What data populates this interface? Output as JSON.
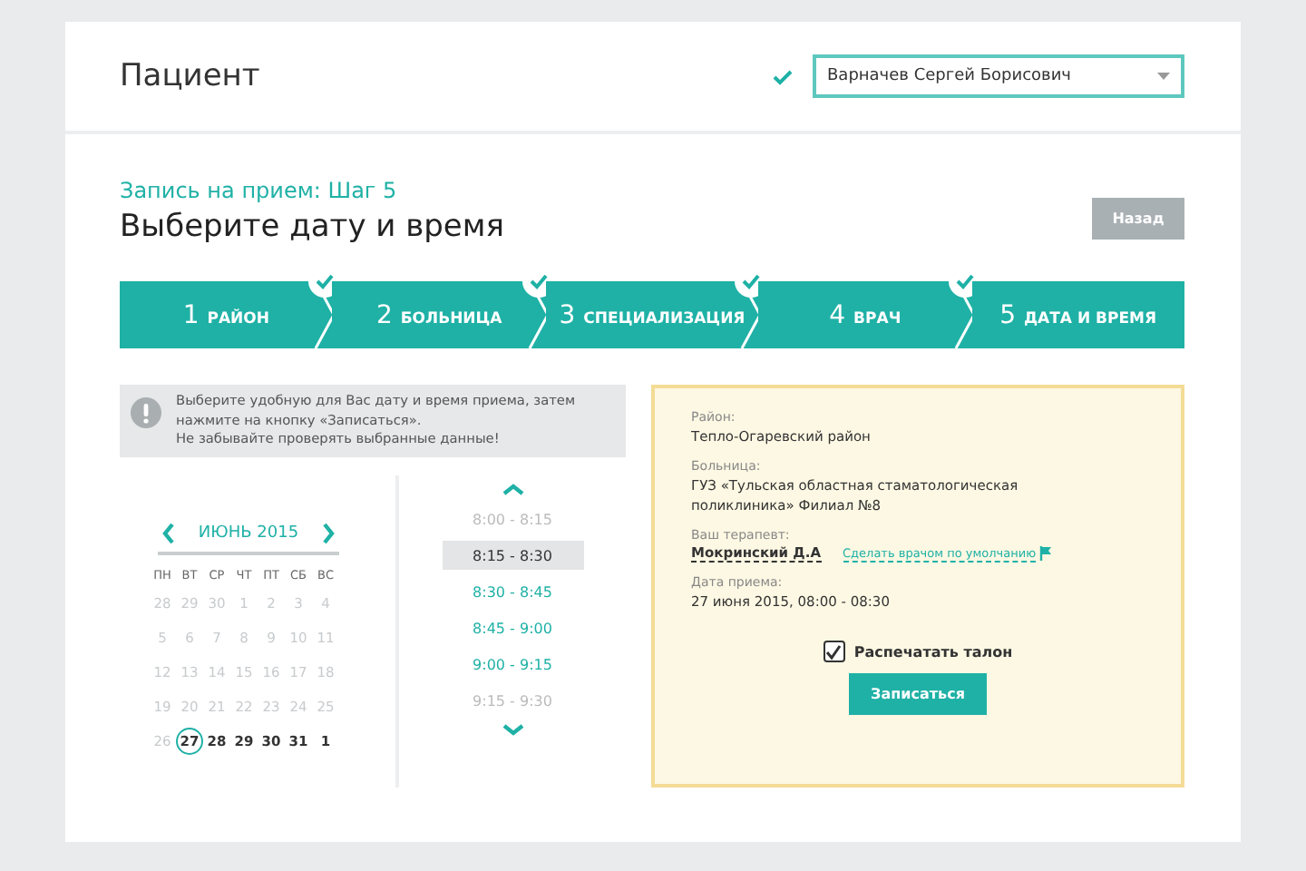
{
  "header": {
    "title": "Пациент",
    "patient_verified": true,
    "patient_select": {
      "value": "Варначев Сергей Борисович"
    }
  },
  "step_label": "Запись на прием: Шаг 5",
  "heading": "Выберите дату и время",
  "back_button": "Назад",
  "steps": [
    {
      "number": "1",
      "label": "РАЙОН",
      "done": true
    },
    {
      "number": "2",
      "label": "БОЛЬНИЦА",
      "done": true
    },
    {
      "number": "3",
      "label": "СПЕЦИАЛИЗАЦИЯ",
      "done": true
    },
    {
      "number": "4",
      "label": "ВРАЧ",
      "done": true
    },
    {
      "number": "5",
      "label": "ДАТА И ВРЕМЯ",
      "done": false
    }
  ],
  "notice": {
    "lines": [
      "Выберите удобную для Вас дату и время приема, затем нажмите на кнопку «Записаться».",
      "Не забывайте проверять выбранные данные!"
    ]
  },
  "calendar": {
    "month": "ИЮНЬ 2015",
    "weekdays": [
      "ПН",
      "ВТ",
      "СР",
      "ЧТ",
      "ПТ",
      "СБ",
      "ВС"
    ],
    "days": [
      {
        "label": "28",
        "disabled": true,
        "selected": false
      },
      {
        "label": "29",
        "disabled": true,
        "selected": false
      },
      {
        "label": "30",
        "disabled": true,
        "selected": false
      },
      {
        "label": "1",
        "disabled": true,
        "selected": false
      },
      {
        "label": "2",
        "disabled": true,
        "selected": false
      },
      {
        "label": "3",
        "disabled": true,
        "selected": false
      },
      {
        "label": "4",
        "disabled": true,
        "selected": false
      },
      {
        "label": "5",
        "disabled": true,
        "selected": false
      },
      {
        "label": "6",
        "disabled": true,
        "selected": false
      },
      {
        "label": "7",
        "disabled": true,
        "selected": false
      },
      {
        "label": "8",
        "disabled": true,
        "selected": false
      },
      {
        "label": "9",
        "disabled": true,
        "selected": false
      },
      {
        "label": "10",
        "disabled": true,
        "selected": false
      },
      {
        "label": "11",
        "disabled": true,
        "selected": false
      },
      {
        "label": "12",
        "disabled": true,
        "selected": false
      },
      {
        "label": "13",
        "disabled": true,
        "selected": false
      },
      {
        "label": "14",
        "disabled": true,
        "selected": false
      },
      {
        "label": "15",
        "disabled": true,
        "selected": false
      },
      {
        "label": "16",
        "disabled": true,
        "selected": false
      },
      {
        "label": "17",
        "disabled": true,
        "selected": false
      },
      {
        "label": "18",
        "disabled": true,
        "selected": false
      },
      {
        "label": "19",
        "disabled": true,
        "selected": false
      },
      {
        "label": "20",
        "disabled": true,
        "selected": false
      },
      {
        "label": "21",
        "disabled": true,
        "selected": false
      },
      {
        "label": "22",
        "disabled": true,
        "selected": false
      },
      {
        "label": "23",
        "disabled": true,
        "selected": false
      },
      {
        "label": "24",
        "disabled": true,
        "selected": false
      },
      {
        "label": "25",
        "disabled": true,
        "selected": false
      },
      {
        "label": "26",
        "disabled": true,
        "selected": false
      },
      {
        "label": "27",
        "disabled": false,
        "selected": true
      },
      {
        "label": "28",
        "disabled": false,
        "selected": false
      },
      {
        "label": "29",
        "disabled": false,
        "selected": false
      },
      {
        "label": "30",
        "disabled": false,
        "selected": false
      },
      {
        "label": "31",
        "disabled": false,
        "selected": false
      },
      {
        "label": "1",
        "disabled": false,
        "selected": false
      }
    ]
  },
  "times": [
    {
      "label": "8:00 - 8:15",
      "disabled": true,
      "selected": false
    },
    {
      "label": "8:15 - 8:30",
      "disabled": false,
      "selected": true
    },
    {
      "label": "8:30 - 8:45",
      "disabled": false,
      "selected": false
    },
    {
      "label": "8:45 - 9:00",
      "disabled": false,
      "selected": false
    },
    {
      "label": "9:00 - 9:15",
      "disabled": false,
      "selected": false
    },
    {
      "label": "9:15 - 9:30",
      "disabled": true,
      "selected": false
    }
  ],
  "summary": {
    "district_label": "Район:",
    "district": "Тепло-Огаревский район",
    "hospital_label": "Больница:",
    "hospital": "ГУЗ «Тульская областная стаматологическая поликлиника» Филиал №8",
    "doctor_label": "Ваш терапевт:",
    "doctor": "Мокринский Д.А",
    "default_link": "Сделать врачом по умолчанию",
    "date_label": "Дата приема:",
    "date": "27 июня 2015, 08:00 - 08:30",
    "print_ticket": {
      "label": "Распечатать талон",
      "checked": true
    },
    "submit_button": "Записаться"
  }
}
